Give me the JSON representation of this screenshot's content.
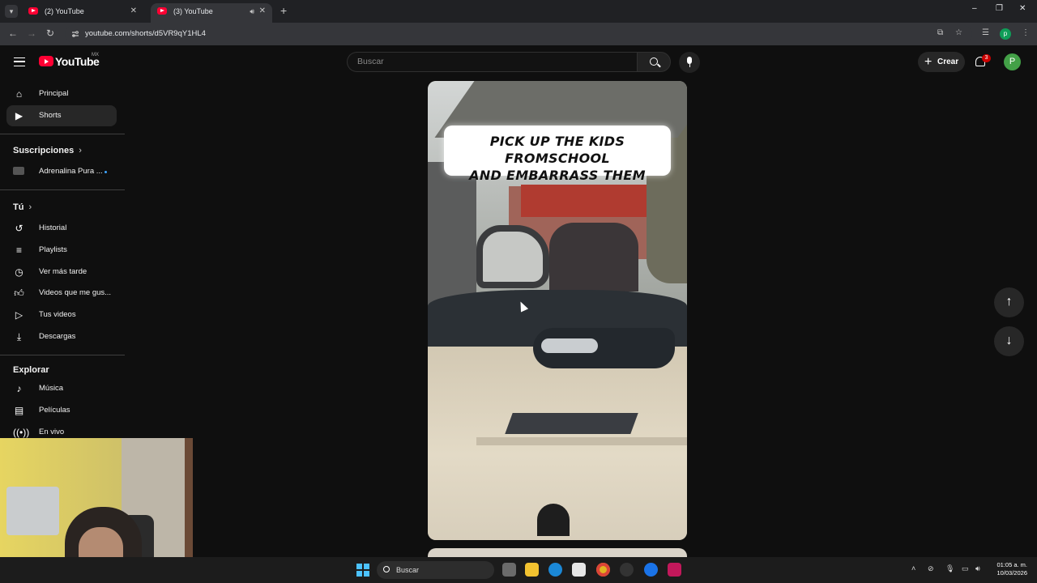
{
  "browser": {
    "tabs": [
      {
        "label": "(2) YouTube"
      },
      {
        "label": "(3) YouTube"
      }
    ],
    "new_tab": "+",
    "url": "youtube.com/shorts/d5VR9qY1HL4",
    "profile_initial": "p",
    "window_controls": [
      "–",
      "❐",
      "✕"
    ]
  },
  "masthead": {
    "logo_text": "YouTube",
    "country_code": "MX",
    "search_placeholder": "Buscar",
    "create_label": "Crear",
    "notifications_count": "3",
    "avatar_initial": "P"
  },
  "sidebar": {
    "main": [
      {
        "label": "Principal",
        "icon": "home-icon"
      },
      {
        "label": "Shorts",
        "icon": "shorts-icon"
      }
    ],
    "subscriptions_header": "Suscripciones",
    "subscriptions": [
      {
        "label": "Adrenalina Pura ...",
        "icon": "channel-avatar"
      }
    ],
    "you_header": "Tú",
    "you": [
      {
        "label": "Historial",
        "icon": "history-icon"
      },
      {
        "label": "Playlists",
        "icon": "playlists-icon"
      },
      {
        "label": "Ver más tarde",
        "icon": "watch-later-icon"
      },
      {
        "label": "Videos que me gus...",
        "icon": "like-icon"
      },
      {
        "label": "Tus videos",
        "icon": "your-videos-icon"
      },
      {
        "label": "Descargas",
        "icon": "download-icon"
      }
    ],
    "explore_header": "Explorar",
    "explore": [
      {
        "label": "Música",
        "icon": "music-icon"
      },
      {
        "label": "Películas",
        "icon": "movies-icon"
      },
      {
        "label": "En vivo",
        "icon": "live-icon"
      }
    ]
  },
  "short": {
    "caption_line1": "PICK UP THE KIDS FROMSCHOOL",
    "caption_line2": "AND EMBARRASS THEM"
  },
  "navigation": {
    "up_arrow": "↑",
    "down_arrow": "↓"
  },
  "taskbar": {
    "search_label": "Buscar",
    "time": "01:05 a. m.",
    "date": "10/03/2026"
  },
  "colors": {
    "background": "#0f0f0f",
    "youtube_red": "#ff0033",
    "sidebar_active": "#272727"
  }
}
